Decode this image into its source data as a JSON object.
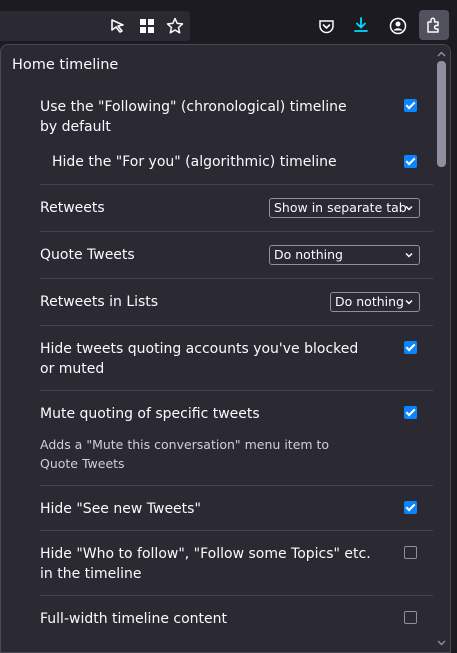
{
  "toolbar": {
    "icons": [
      "tracking-protection-icon",
      "grid-icon",
      "star-icon",
      "pocket-icon",
      "download-icon",
      "account-icon",
      "extensions-icon"
    ]
  },
  "panel": {
    "section_title": "Home timeline",
    "rows": {
      "following_default": {
        "label": "Use the \"Following\" (chronological) timeline by default",
        "checked": true
      },
      "hide_for_you": {
        "label": "Hide the \"For you\" (algorithmic) timeline",
        "checked": true
      },
      "retweets": {
        "label": "Retweets",
        "value": "Show in separate tab"
      },
      "quote_tweets": {
        "label": "Quote Tweets",
        "value": "Do nothing"
      },
      "retweets_lists": {
        "label": "Retweets in Lists",
        "value": "Do nothing"
      },
      "hide_blocked_quotes": {
        "label": "Hide tweets quoting accounts you've blocked or muted",
        "checked": true
      },
      "mute_quoting": {
        "label": "Mute quoting of specific tweets",
        "checked": true,
        "description": "Adds a \"Mute this conversation\" menu item to Quote Tweets"
      },
      "hide_see_new": {
        "label": "Hide \"See new Tweets\"",
        "checked": true
      },
      "hide_who_to_follow": {
        "label": "Hide \"Who to follow\", \"Follow some Topics\" etc. in the timeline",
        "checked": false
      },
      "full_width": {
        "label": "Full-width timeline content",
        "checked": false
      }
    }
  },
  "colors": {
    "accent": "#0a84ff",
    "panel_bg": "#2b2a33",
    "toolbar_bg": "#1c1b22"
  }
}
